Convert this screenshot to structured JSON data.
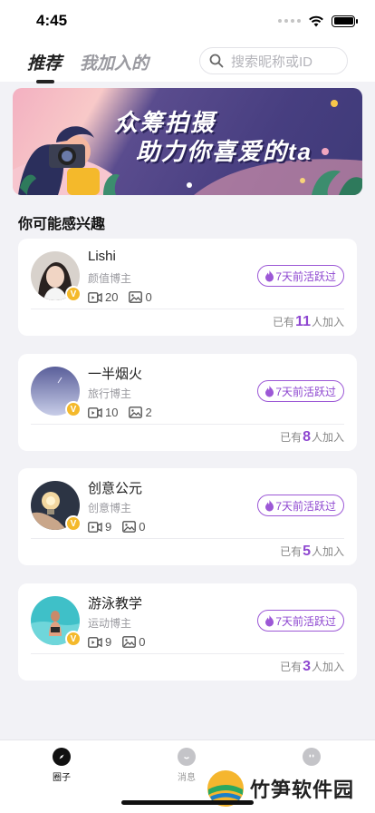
{
  "status": {
    "time": "4:45"
  },
  "header": {
    "tabs": [
      {
        "label": "推荐",
        "active": true
      },
      {
        "label": "我加入的",
        "active": false
      }
    ],
    "search_placeholder": "搜索昵称或ID"
  },
  "banner": {
    "line1": "众筹拍摄",
    "line2": "助力你喜爱的ta"
  },
  "section_title": "你可能感兴趣",
  "cards": [
    {
      "name": "Lishi",
      "category": "颜值博主",
      "videos": "20",
      "photos": "0",
      "active": "7天前活跃过",
      "joined_prefix": "已有",
      "joined_count": "11",
      "joined_suffix": "人加入",
      "avatar": "portrait"
    },
    {
      "name": "一半烟火",
      "category": "旅行博主",
      "videos": "10",
      "photos": "2",
      "active": "7天前活跃过",
      "joined_prefix": "已有",
      "joined_count": "8",
      "joined_suffix": "人加入",
      "avatar": "sky"
    },
    {
      "name": "创意公元",
      "category": "创意博主",
      "videos": "9",
      "photos": "0",
      "active": "7天前活跃过",
      "joined_prefix": "已有",
      "joined_count": "5",
      "joined_suffix": "人加入",
      "avatar": "lightbulb"
    },
    {
      "name": "游泳教学",
      "category": "运动博主",
      "videos": "9",
      "photos": "0",
      "active": "7天前活跃过",
      "joined_prefix": "已有",
      "joined_count": "3",
      "joined_suffix": "人加入",
      "avatar": "pool"
    }
  ],
  "tabbar": [
    {
      "label": "圈子",
      "icon": "compass-icon",
      "active": true
    },
    {
      "label": "消息",
      "icon": "message-smile-icon",
      "active": false
    },
    {
      "label": "",
      "icon": "profile-face-icon",
      "active": false
    }
  ],
  "watermark": "竹笋软件园",
  "colors": {
    "accent": "#8e47d0",
    "badge": "#f4b92b"
  }
}
